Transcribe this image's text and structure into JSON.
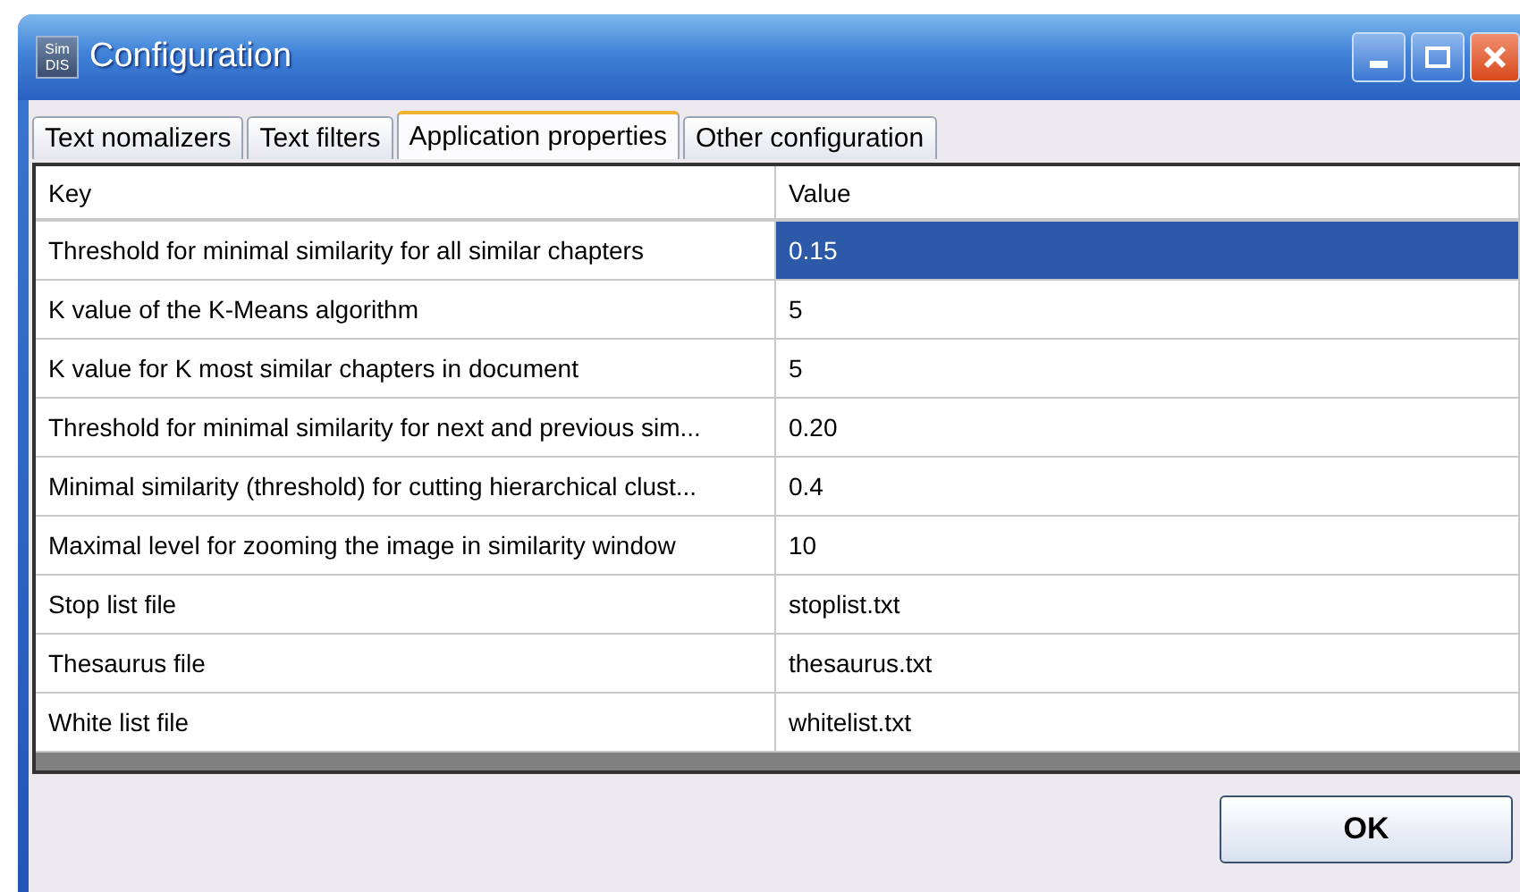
{
  "window": {
    "logo_top": "Sim",
    "logo_bottom": "DIS",
    "title": "Configuration"
  },
  "tabs": [
    {
      "label": "Text nomalizers",
      "selected": false
    },
    {
      "label": "Text filters",
      "selected": false
    },
    {
      "label": "Application properties",
      "selected": true
    },
    {
      "label": "Other configuration",
      "selected": false
    }
  ],
  "table": {
    "columns": [
      "Key",
      "Value"
    ],
    "rows": [
      {
        "key": "Threshold for minimal similarity for all similar chapters",
        "value": "0.15",
        "selected": true
      },
      {
        "key": "K value of the K-Means algorithm",
        "value": "5",
        "selected": false
      },
      {
        "key": "K value for K most similar chapters in document",
        "value": "5",
        "selected": false
      },
      {
        "key": "Threshold for minimal similarity for next and previous sim...",
        "value": "0.20",
        "selected": false
      },
      {
        "key": "Minimal similarity (threshold) for cutting hierarchical clust...",
        "value": "0.4",
        "selected": false
      },
      {
        "key": "Maximal level for zooming the image in similarity window",
        "value": "10",
        "selected": false
      },
      {
        "key": "Stop list file",
        "value": "stoplist.txt",
        "selected": false
      },
      {
        "key": "Thesaurus file",
        "value": "thesaurus.txt",
        "selected": false
      },
      {
        "key": "White list file",
        "value": "whitelist.txt",
        "selected": false
      }
    ]
  },
  "buttons": [
    "OK"
  ]
}
